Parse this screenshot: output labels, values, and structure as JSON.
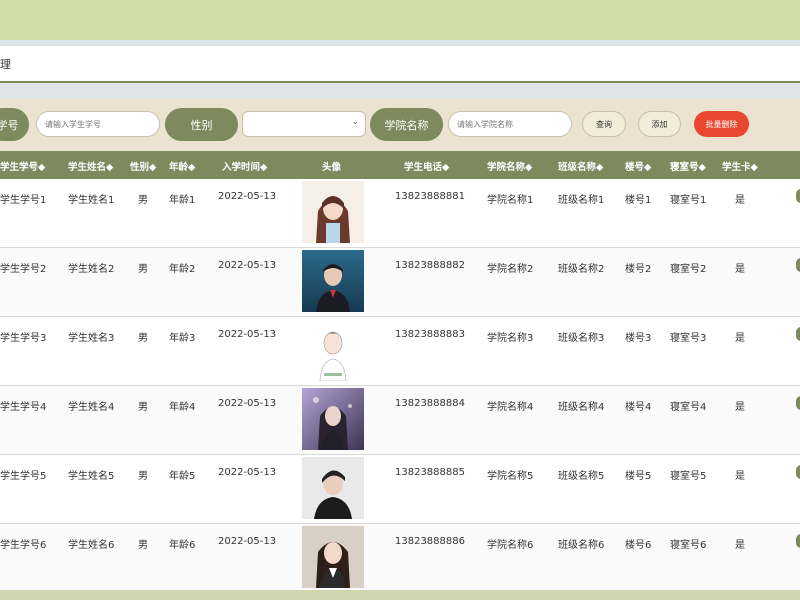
{
  "breadcrumb": "理",
  "search": {
    "student_no_label": "学号",
    "student_no_placeholder": "请输入学生学号",
    "gender_label": "性别",
    "gender_value": "",
    "college_label": "学院名称",
    "college_placeholder": "请输入学院名称",
    "query_button": "查询",
    "add_button": "添加",
    "batch_delete_button": "批量删除"
  },
  "table": {
    "columns": [
      "学生学号◆",
      "学生姓名◆",
      "性别◆",
      "年龄◆",
      "入学时间◆",
      "头像",
      "学生电话◆",
      "学院名称◆",
      "班级名称◆",
      "楼号◆",
      "寝室号◆",
      "学生卡◆"
    ],
    "rows": [
      {
        "student_no": "学生学号1",
        "name": "学生姓名1",
        "gender": "男",
        "age": "年龄1",
        "enroll_date": "2022-05-13",
        "phone": "13823888881",
        "college": "学院名称1",
        "class": "班级名称1",
        "building": "楼号1",
        "room": "寝室号1",
        "card": "是"
      },
      {
        "student_no": "学生学号2",
        "name": "学生姓名2",
        "gender": "男",
        "age": "年龄2",
        "enroll_date": "2022-05-13",
        "phone": "13823888882",
        "college": "学院名称2",
        "class": "班级名称2",
        "building": "楼号2",
        "room": "寝室号2",
        "card": "是"
      },
      {
        "student_no": "学生学号3",
        "name": "学生姓名3",
        "gender": "男",
        "age": "年龄3",
        "enroll_date": "2022-05-13",
        "phone": "13823888883",
        "college": "学院名称3",
        "class": "班级名称3",
        "building": "楼号3",
        "room": "寝室号3",
        "card": "是"
      },
      {
        "student_no": "学生学号4",
        "name": "学生姓名4",
        "gender": "男",
        "age": "年龄4",
        "enroll_date": "2022-05-13",
        "phone": "13823888884",
        "college": "学院名称4",
        "class": "班级名称4",
        "building": "楼号4",
        "room": "寝室号4",
        "card": "是"
      },
      {
        "student_no": "学生学号5",
        "name": "学生姓名5",
        "gender": "男",
        "age": "年龄5",
        "enroll_date": "2022-05-13",
        "phone": "13823888885",
        "college": "学院名称5",
        "class": "班级名称5",
        "building": "楼号5",
        "room": "寝室号5",
        "card": "是"
      },
      {
        "student_no": "学生学号6",
        "name": "学生姓名6",
        "gender": "男",
        "age": "年龄6",
        "enroll_date": "2022-05-13",
        "phone": "13823888886",
        "college": "学院名称6",
        "class": "班级名称6",
        "building": "楼号6",
        "room": "寝室号6",
        "card": "是"
      }
    ]
  },
  "colors": {
    "accent": "#7d8a5e",
    "topbar": "#d3dda6",
    "search_bg": "#ebe2cf",
    "danger": "#e9472f"
  },
  "icons": {
    "select_arrow": "chevron-down-icon",
    "avatar": "avatar-image"
  }
}
